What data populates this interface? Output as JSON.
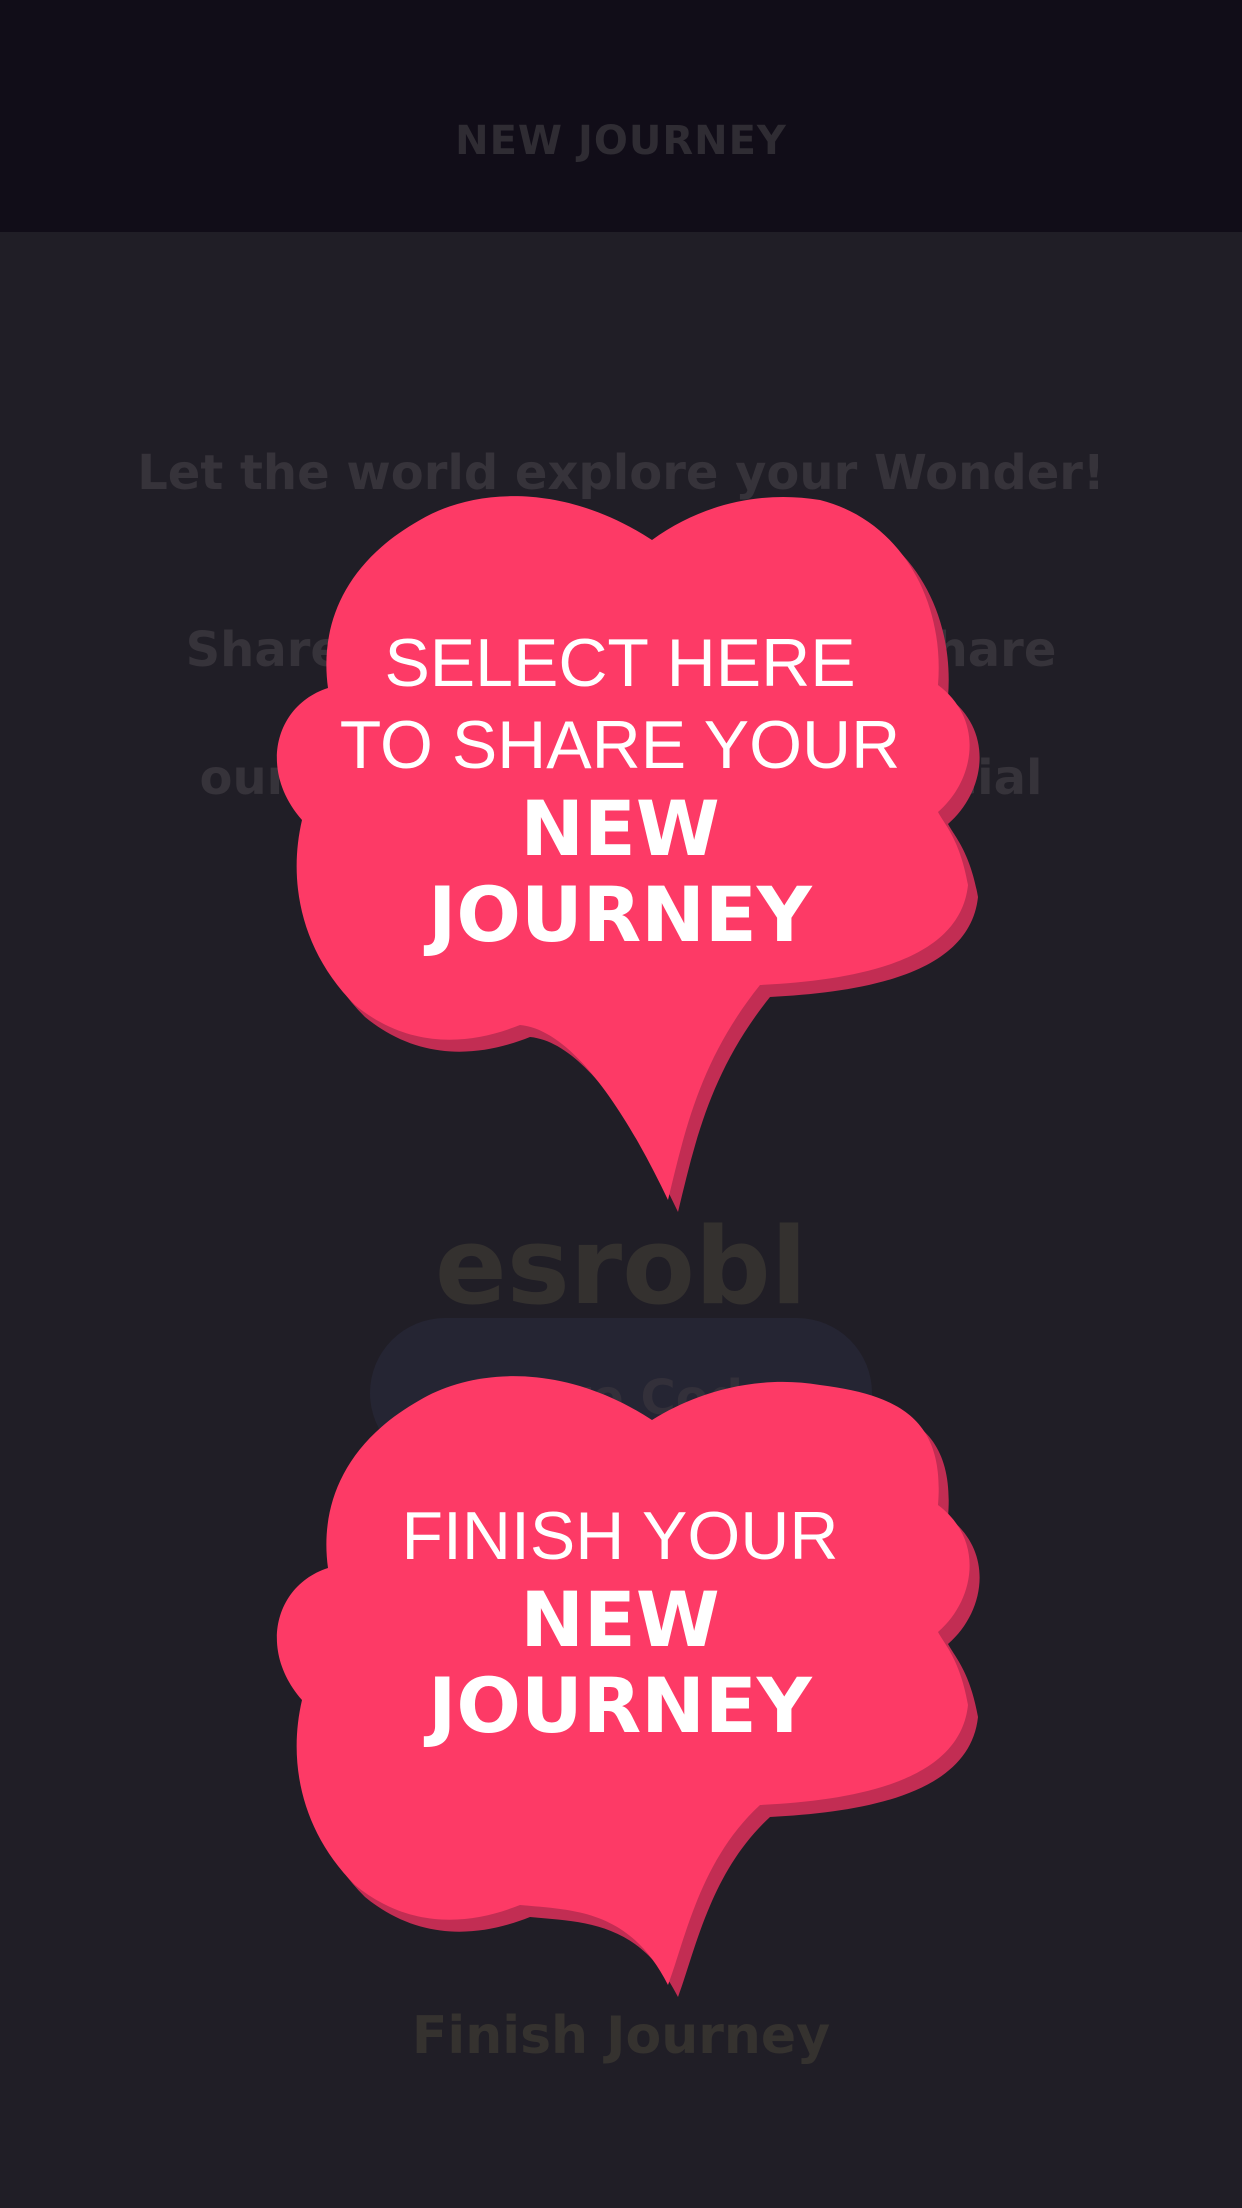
{
  "header": {
    "title": "NEW JOURNEY"
  },
  "main": {
    "headline": "Let the world explore your Wonder!",
    "subtext_line1": "Share it using the code or share using",
    "subtext_line2": "our social media icon via social",
    "code": "esrobl",
    "share_button_label": "Share Code",
    "finish_button_label": "Finish Journey"
  },
  "tutorial": {
    "bubble1": {
      "line1": "SELECT HERE",
      "line2": "TO SHARE YOUR",
      "line3": "NEW",
      "line4": "JOURNEY"
    },
    "bubble2": {
      "line1": "FINISH YOUR",
      "line2": "NEW",
      "line3": "JOURNEY"
    }
  },
  "colors": {
    "bubble_fill": "#fd3a66",
    "bubble_shadow": "#c22d53",
    "topbar": "#110d18",
    "background": "#201e26"
  }
}
